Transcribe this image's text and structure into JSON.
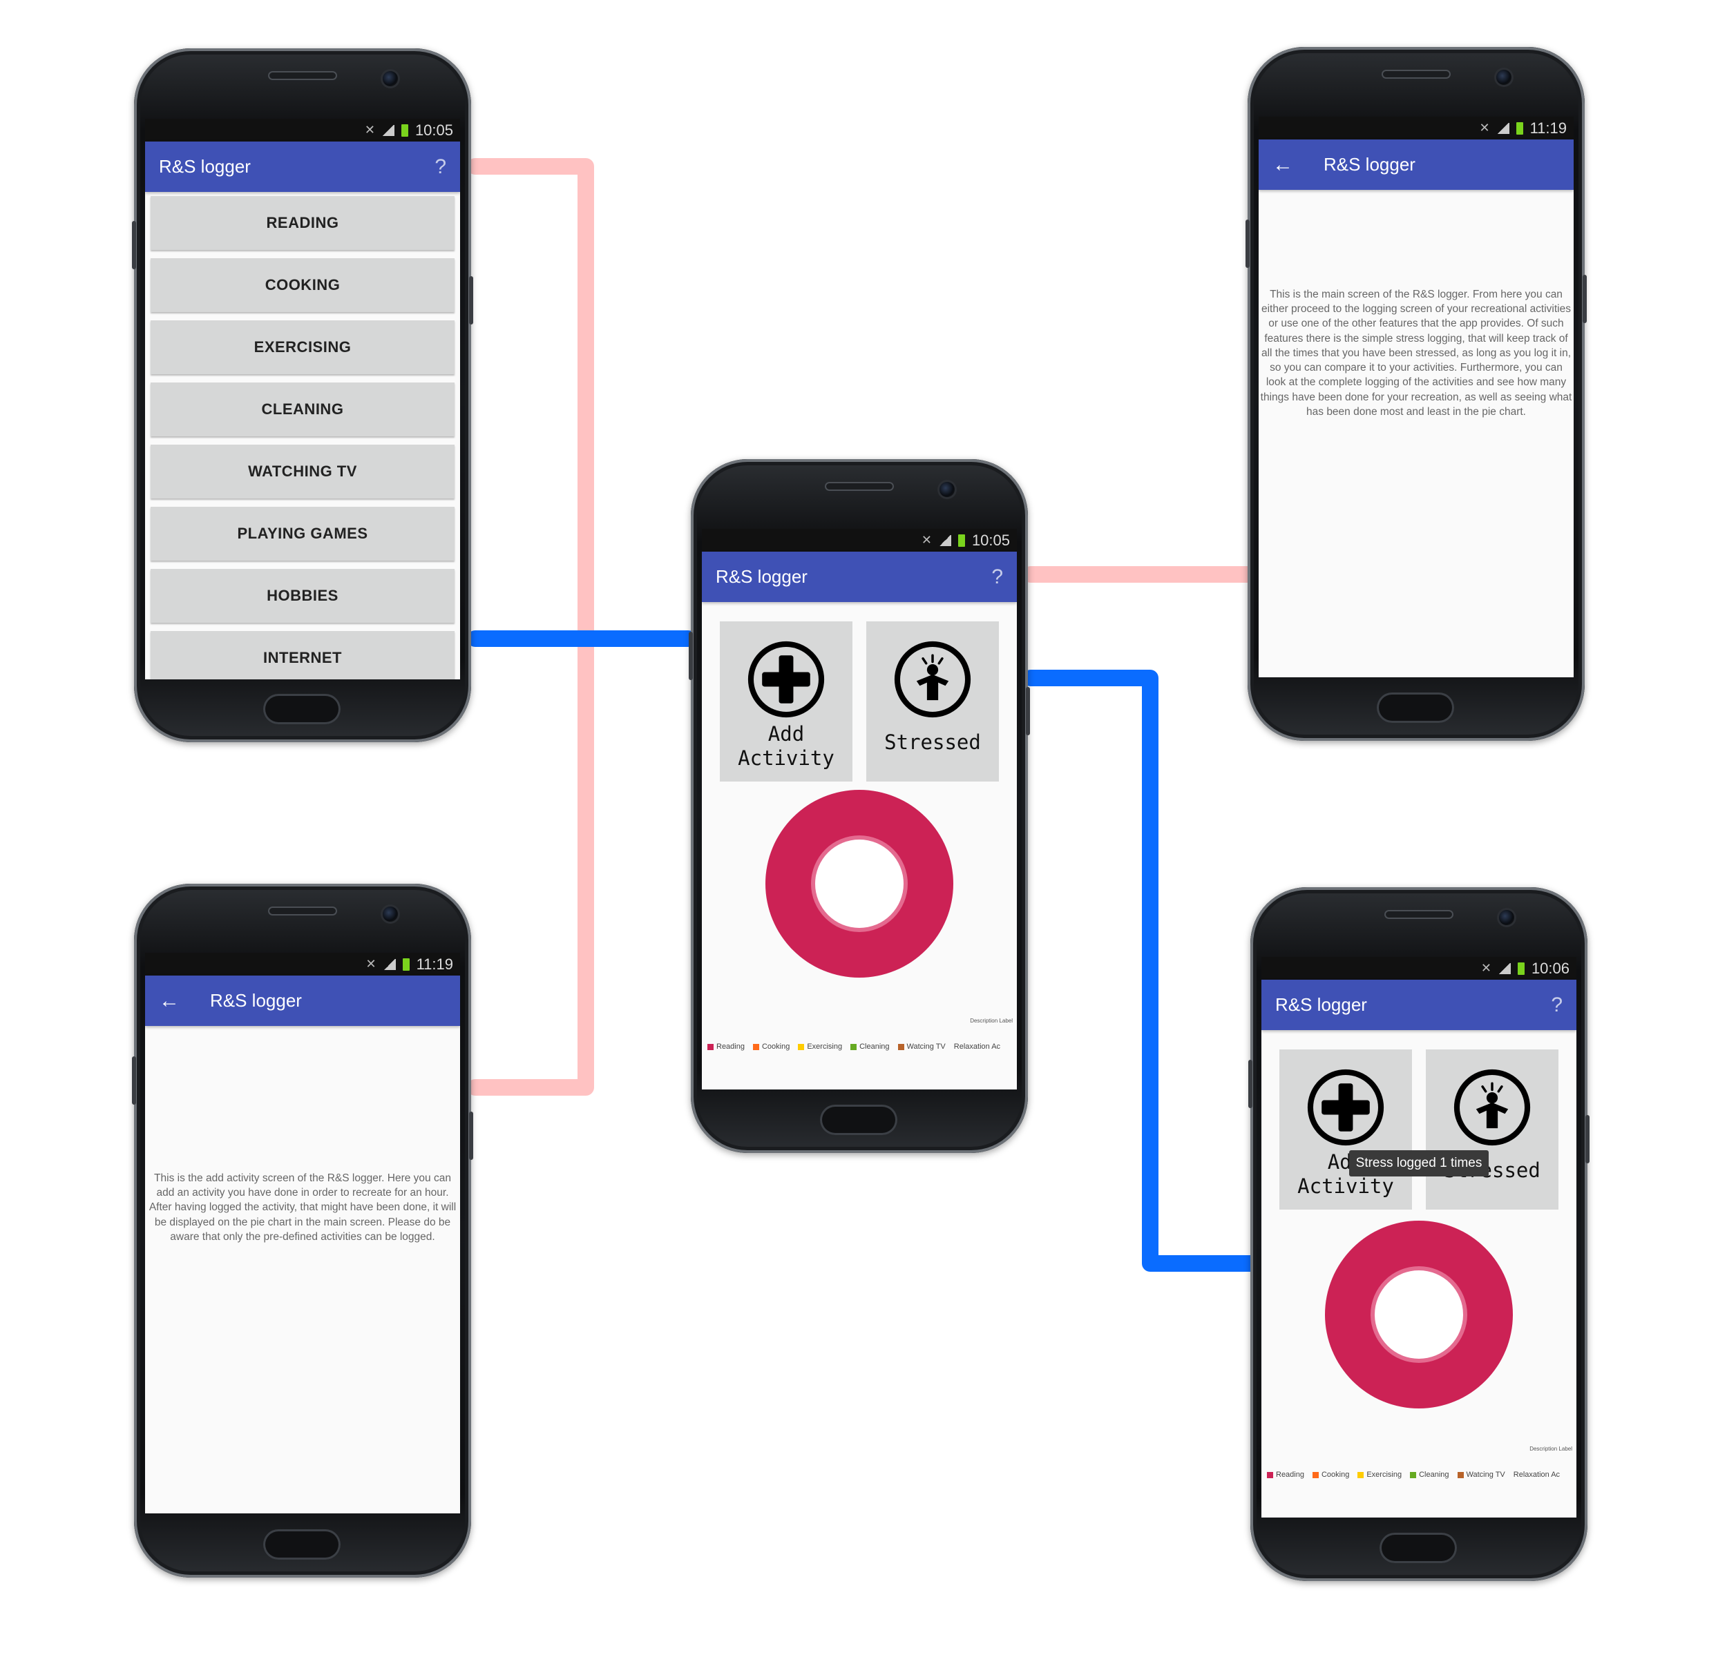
{
  "app": {
    "title": "R&S logger",
    "help_glyph": "?",
    "back_glyph": "←"
  },
  "colors": {
    "app_bar": "#3f51b5",
    "connector_pink": "#ffc2c2",
    "connector_blue": "#0a6cff",
    "pie_fill": "#cc2255",
    "tile_bg": "#d7d8d8"
  },
  "phones": {
    "menu": {
      "time": "10:05",
      "items": [
        "READING",
        "COOKING",
        "EXERCISING",
        "CLEANING",
        "WATCHING TV",
        "PLAYING GAMES",
        "HOBBIES",
        "INTERNET"
      ]
    },
    "main": {
      "time": "10:05",
      "add_activity_label": "Add\nActivity",
      "stressed_label": "Stressed",
      "description_label": "Description Label",
      "legend": [
        "Reading",
        "Cooking",
        "Exercising",
        "Cleaning",
        "Watcing TV",
        "Relaxation Ac"
      ]
    },
    "help_main": {
      "time": "11:19",
      "text": "This is the main screen of the R&S logger. From here you can either proceed to the logging screen of your recreational activities or use one of the other features that the app provides. Of such features there is the simple stress logging, that will keep track of all the times that you have been stressed, as long as you log it in, so you can compare it to your activities. Furthermore, you can look at the complete logging of the activities and see how many things have been done for your recreation, as well as seeing what has been done most and least in the pie chart."
    },
    "help_add": {
      "time": "11:19",
      "text": "This is the add activity screen of the R&S logger. Here you can add an activity you have done in order to recreate for an hour. After having logged the activity, that might have been done, it will be displayed on the pie chart in the main screen. Please do be aware that only the pre-defined activities can be logged."
    },
    "main_toast": {
      "time": "10:06",
      "add_activity_label": "Add\nActivity",
      "stressed_label": "Stressed",
      "toast": "Stress logged 1 times",
      "description_label": "Description Label",
      "legend": [
        "Reading",
        "Cooking",
        "Exercising",
        "Cleaning",
        "Watcing TV",
        "Relaxation Ac"
      ]
    }
  },
  "legend_colors": [
    "#cc2255",
    "#ff6a1a",
    "#ffcc00",
    "#66aa22",
    "#b8632a",
    "#999999"
  ],
  "icons": {
    "add": "plus-circle-icon",
    "stressed": "stressed-person-icon",
    "mute": "mute-icon",
    "signal": "signal-icon",
    "battery": "battery-icon"
  }
}
